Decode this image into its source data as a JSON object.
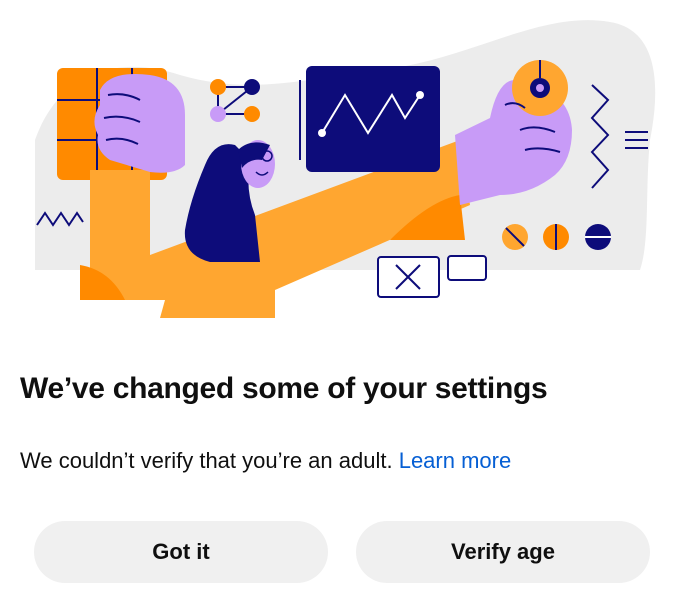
{
  "dialog": {
    "title": "We’ve changed some of your settings",
    "message": "We couldn’t verify that you’re an adult.",
    "learn_more_label": "Learn more",
    "buttons": {
      "got_it_label": "Got it",
      "verify_age_label": "Verify age"
    }
  },
  "illustration": {
    "icon": "settings-illustration",
    "colors": {
      "orange": "#ffa630",
      "dark_orange": "#ff8a00",
      "purple": "#c89bf7",
      "navy": "#0d0c7a",
      "gray_bg": "#ececec"
    }
  },
  "colors": {
    "link": "#065fd4",
    "button_bg": "#f0f0f0",
    "text": "#0f0f0f"
  }
}
